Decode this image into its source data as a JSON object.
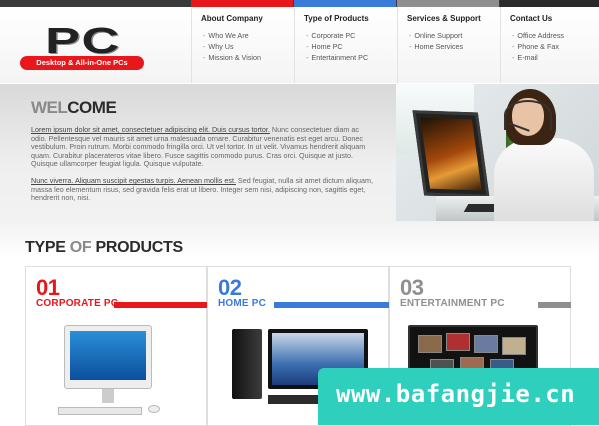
{
  "colors": {
    "red": "#e8171c",
    "blue": "#3c7ad9",
    "gray": "#8f8f8f",
    "dark": "#2b2b2b"
  },
  "logo": {
    "text": "PC",
    "tagline": "Desktop & All-in-One PCs"
  },
  "nav": [
    {
      "title": "About Company",
      "items": [
        "Who We Are",
        "Why Us",
        "Mission & Vision"
      ]
    },
    {
      "title": "Type of Products",
      "items": [
        "Corporate PC",
        "Home PC",
        "Entertainment PC"
      ]
    },
    {
      "title": "Services & Support",
      "items": [
        "Online Support",
        "Home Services"
      ]
    },
    {
      "title": "Contact Us",
      "items": [
        "Office Address",
        "Phone & Fax",
        "E-mail"
      ]
    }
  ],
  "welcome": {
    "heading_light": "WEL",
    "heading_dark": "COME",
    "p1_link": "Lorem ipsum dolor sit amet, consectetuer adipiscing elit. Duis cursus tortor.",
    "p1_rest": " Nunc consectetuer diam ac odio. Pellentesque vel mauris sit amet urna malesuada ornare. Curabitur venenatis est eget arcu. Donec vestibulum. Proin rutrum. Morbi commodo fringilla orci. Ut vel tortor. In ut velit. Vivamus hendrerit aliquam quam. Curabitur placerateros vitae libero. Fusce sagittis commodo purus. Cras orci. Quisque at justo. Quisque ullamcorper feugiat ligula. Quisque vulputate.",
    "p2_link": "Nunc viverra. Aliquam suscipit egestas turpis. Aenean mollis est.",
    "p2_rest": " Sed feugiat, nulla sit amet dictum aliquam, massa leo elementum risus, sed gravida felis erat ut libero. Integer sem nisi, adipiscing non, sagittis eget, hendrerit non, nisi."
  },
  "types": {
    "heading_a": "TYPE ",
    "heading_b": "OF",
    "heading_c": " PRODUCTS",
    "cards": [
      {
        "num": "01",
        "title": "CORPORATE PC",
        "color": "#e8171c"
      },
      {
        "num": "02",
        "title": "HOME PC",
        "color": "#3c7ad9"
      },
      {
        "num": "03",
        "title": "ENTERTAINMENT PC",
        "color": "#8f8f8f"
      }
    ]
  },
  "watermark": "www.bafangjie.cn"
}
